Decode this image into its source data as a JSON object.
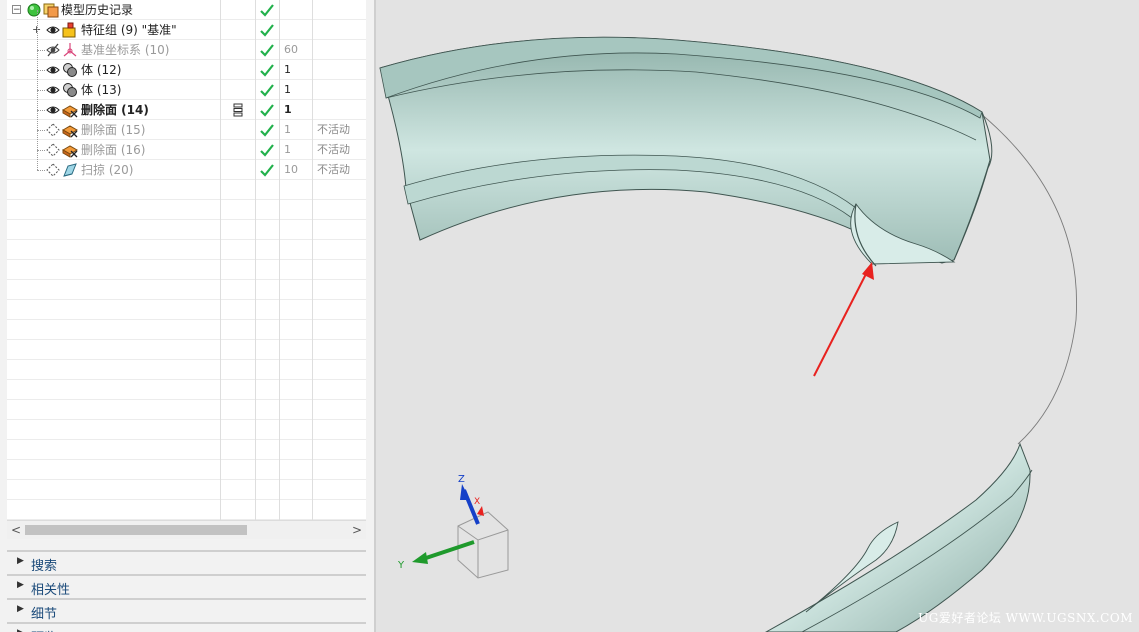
{
  "tree": {
    "rows": [
      {
        "label": "模型历史记录",
        "upd": "",
        "rem": ""
      },
      {
        "label": "特征组 (9) \"基准\"",
        "upd": "",
        "rem": ""
      },
      {
        "label": "基准坐标系 (10)",
        "upd": "60",
        "rem": ""
      },
      {
        "label": "体 (12)",
        "upd": "1",
        "rem": ""
      },
      {
        "label": "体 (13)",
        "upd": "1",
        "rem": ""
      },
      {
        "label": "删除面 (14)",
        "upd": "1",
        "rem": ""
      },
      {
        "label": "删除面 (15)",
        "upd": "1",
        "rem": "不活动"
      },
      {
        "label": "删除面 (16)",
        "upd": "1",
        "rem": "不活动"
      },
      {
        "label": "扫掠 (20)",
        "upd": "10",
        "rem": "不活动"
      }
    ]
  },
  "panels": {
    "search": "搜索",
    "dependencies": "相关性",
    "details": "细节",
    "preview": "预览"
  },
  "scroll": {
    "left": "<",
    "right": ">"
  },
  "triad": {
    "z": "Z",
    "x": "X",
    "y": "Y"
  },
  "watermark": "UG爱好者论坛 WWW.UGSNX.COM",
  "colors": {
    "check": "#22b14c",
    "arrow": "#e8221f",
    "surface": "#b9d2cc",
    "axis_z": "#1540c8",
    "axis_y": "#1f9a2c"
  }
}
